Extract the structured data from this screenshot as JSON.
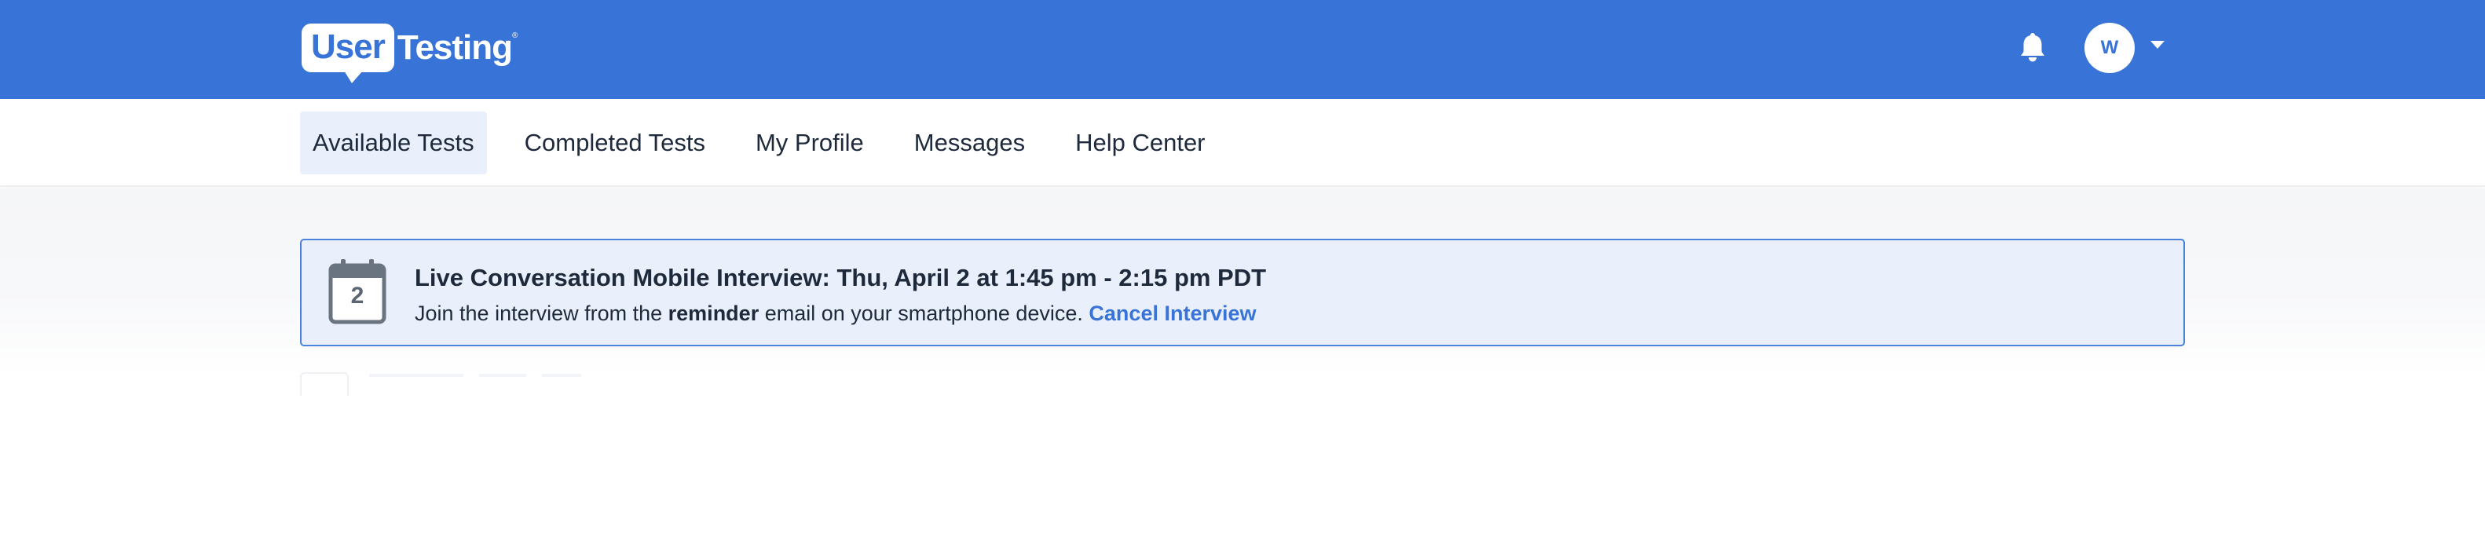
{
  "header": {
    "logo": {
      "word1": "User",
      "word2": "Testing",
      "tm": "®"
    },
    "notifications_icon": "bell-icon",
    "avatar_initial": "W",
    "brand_color": "#3873d8"
  },
  "nav": {
    "items": [
      {
        "label": "Available Tests",
        "active": true
      },
      {
        "label": "Completed Tests",
        "active": false
      },
      {
        "label": "My Profile",
        "active": false
      },
      {
        "label": "Messages",
        "active": false
      },
      {
        "label": "Help Center",
        "active": false
      }
    ]
  },
  "banner": {
    "icon": "calendar-icon",
    "calendar_day": "2",
    "title": "Live Conversation Mobile Interview: Thu, April 2 at 1:45 pm - 2:15 pm PDT",
    "text_before": "Join the interview from the ",
    "text_bold": "reminder",
    "text_after": " email on your smartphone device. ",
    "cancel_label": "Cancel Interview"
  }
}
